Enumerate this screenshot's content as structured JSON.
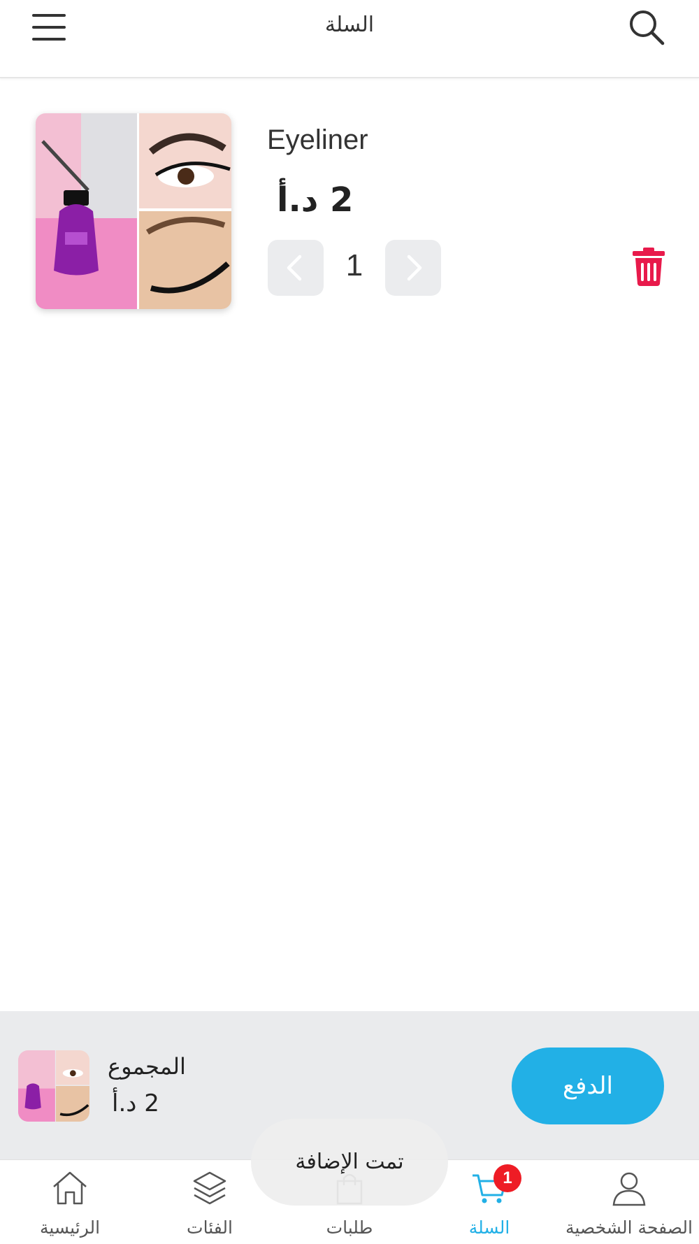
{
  "header": {
    "title": "السلة"
  },
  "cart_item": {
    "name": "Eyeliner",
    "price": "2 د.أ",
    "quantity": "1"
  },
  "summary": {
    "total_label": "المجموع",
    "total_value": "2 د.أ",
    "pay_label": "الدفع"
  },
  "nav": {
    "items": [
      {
        "label": "الصفحة الشخصية",
        "icon": "user-icon"
      },
      {
        "label": "السلة",
        "icon": "cart-icon",
        "badge": "1",
        "active": true
      },
      {
        "label": "طلبات",
        "icon": "shopping-bag-icon"
      },
      {
        "label": "الفئات",
        "icon": "layers-icon"
      },
      {
        "label": "الرئيسية",
        "icon": "home-icon"
      }
    ]
  },
  "toast": {
    "message": "تمت الإضافة"
  },
  "colors": {
    "accent": "#22b0e6",
    "delete": "#e81a4b",
    "badge": "#ee1c25",
    "summary_bg": "#eaebed"
  }
}
